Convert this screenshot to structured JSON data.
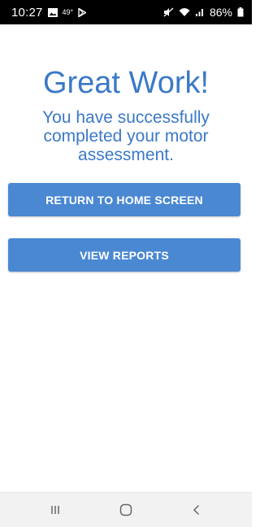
{
  "status_bar": {
    "time": "10:27",
    "temperature": "49°",
    "battery": "86%",
    "icons": [
      "gallery-icon",
      "play-store-icon",
      "mute-icon",
      "wifi-icon",
      "signal-icon",
      "battery-icon"
    ]
  },
  "main": {
    "title": "Great Work!",
    "message": "You have successfully completed your motor assessment."
  },
  "buttons": {
    "home_label": "RETURN TO HOME SCREEN",
    "reports_label": "VIEW REPORTS"
  },
  "nav_bar": {
    "icons": [
      "recent-apps-icon",
      "home-icon",
      "back-icon"
    ]
  },
  "colors": {
    "accent": "#3b79c7",
    "button": "#4a88d2",
    "status_bar": "#000000",
    "nav_bar": "#f2f2f2"
  }
}
